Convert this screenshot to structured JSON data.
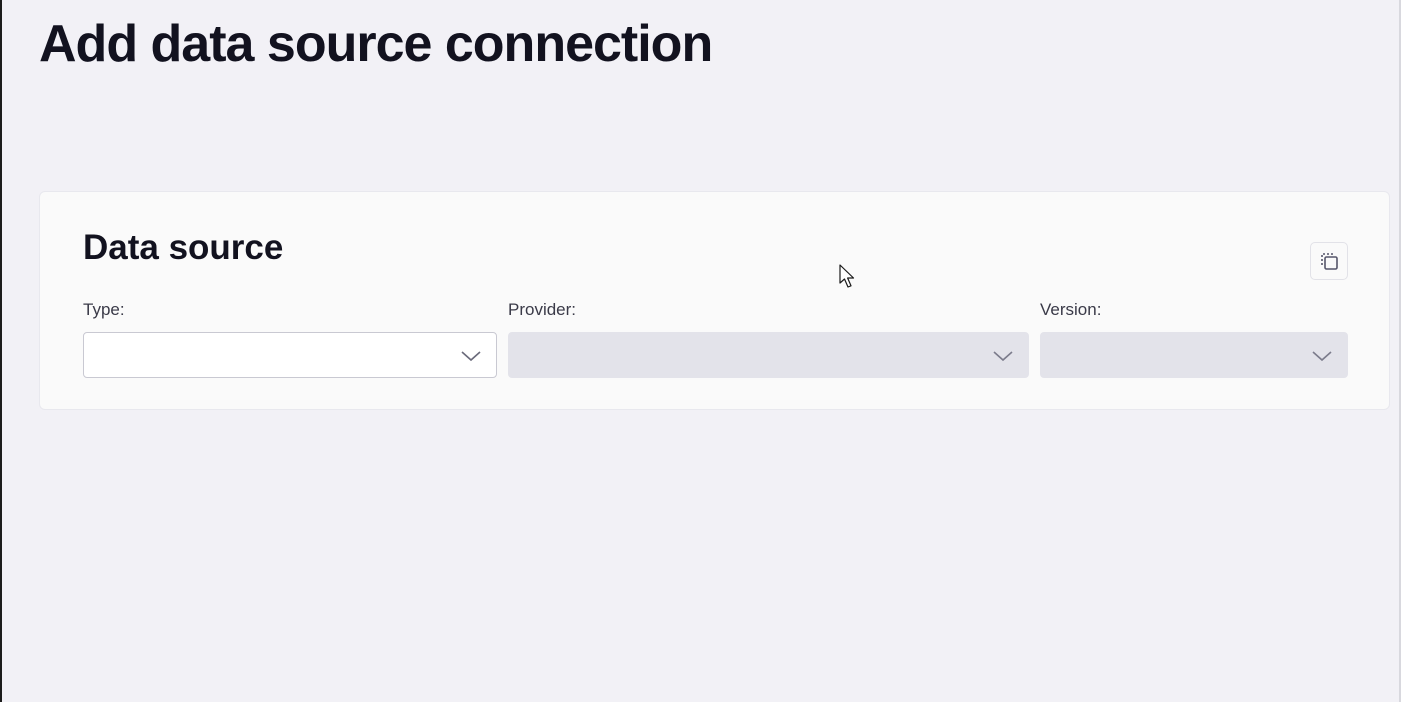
{
  "page": {
    "title": "Add data source connection"
  },
  "data_source": {
    "heading": "Data source",
    "copy_icon": "copy-icon",
    "fields": [
      {
        "label": "Type:",
        "value": "",
        "disabled": false
      },
      {
        "label": "Provider:",
        "value": "",
        "disabled": true
      },
      {
        "label": "Version:",
        "value": "",
        "disabled": true
      }
    ]
  },
  "colors": {
    "background": "#f2f1f6",
    "card": "#fafafa",
    "disabled_field": "#e3e3ea",
    "text_dark": "#12121f"
  }
}
